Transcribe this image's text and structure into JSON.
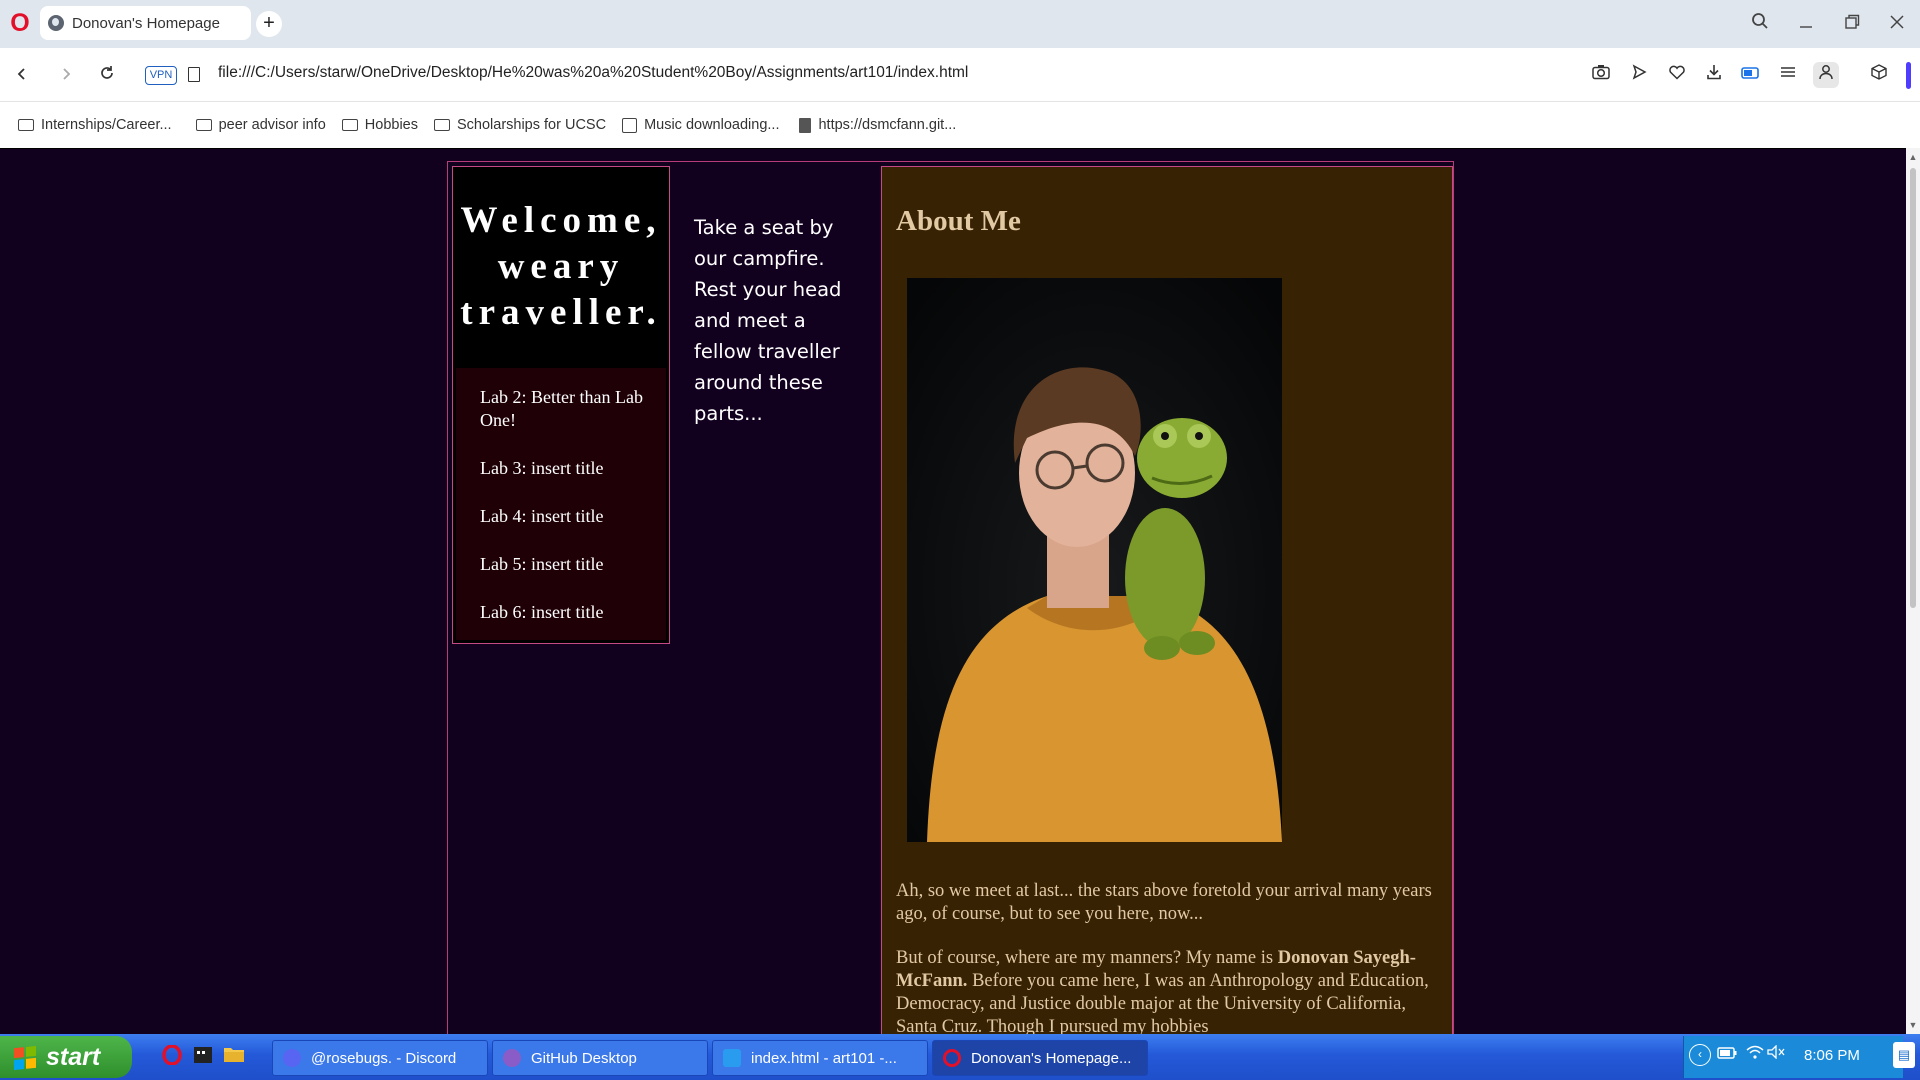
{
  "browser": {
    "tab_title": "Donovan's Homepage",
    "new_tab_symbol": "+",
    "vpn_label": "VPN",
    "url": "file:///C:/Users/starw/OneDrive/Desktop/He%20was%20a%20Student%20Boy/Assignments/art101/index.html",
    "bookmarks": [
      {
        "label": "Internships/Career...",
        "icon": "folder-icon"
      },
      {
        "label": "peer advisor info",
        "icon": "folder-icon"
      },
      {
        "label": "Hobbies",
        "icon": "folder-icon"
      },
      {
        "label": "Scholarships for UCSC",
        "icon": "folder-icon"
      },
      {
        "label": "Music downloading...",
        "icon": "download-page-icon"
      },
      {
        "label": "https://dsmcfann.git...",
        "icon": "document-icon"
      }
    ],
    "accent_color": "#4f3dff"
  },
  "page": {
    "welcome_heading": "Welcome, weary traveller.",
    "labs": [
      "Lab 2: Better than Lab One!",
      "Lab 3: insert title",
      "Lab 4: insert title",
      "Lab 5: insert title",
      "Lab 6: insert title"
    ],
    "campfire_text": "Take a seat by our campfire. Rest your head and meet a fellow traveller around these parts...",
    "about": {
      "heading": "About Me",
      "paragraph1": "Ah, so we meet at last... the stars above foretold your arrival many years ago, of course, but to see you here, now...",
      "paragraph2_before": "But of course, where are my manners? My name is ",
      "paragraph2_name": "Donovan Sayegh-McFann.",
      "paragraph2_after": " Before you came here, I was an Anthropology and Education, Democracy, and Justice double major at the University of California, Santa Cruz. Though I pursued my hobbies"
    },
    "colors": {
      "background": "#12001f",
      "border": "#c34a84",
      "about_bg": "#382204",
      "about_text": "#e1c9a4"
    }
  },
  "taskbar": {
    "start_label": "start",
    "tasks": [
      {
        "label": "@rosebugs. - Discord",
        "icon": "discord-icon"
      },
      {
        "label": "GitHub Desktop",
        "icon": "github-icon"
      },
      {
        "label": "index.html - art101 -...",
        "icon": "vscode-icon"
      },
      {
        "label": "Donovan's Homepage...",
        "icon": "opera-icon",
        "active": true
      }
    ],
    "clock": "8:06 PM"
  }
}
